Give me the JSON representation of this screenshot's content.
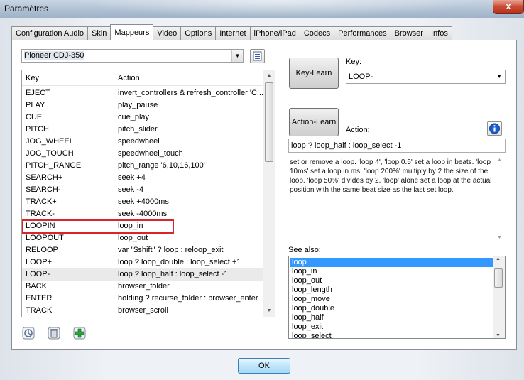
{
  "window": {
    "title": "Paramètres",
    "close_label": "x"
  },
  "tabs": [
    {
      "label": "Configuration Audio",
      "active": false
    },
    {
      "label": "Skin",
      "active": false
    },
    {
      "label": "Mappeurs",
      "active": true
    },
    {
      "label": "Video",
      "active": false
    },
    {
      "label": "Options",
      "active": false
    },
    {
      "label": "Internet",
      "active": false
    },
    {
      "label": "iPhone/iPad",
      "active": false
    },
    {
      "label": "Codecs",
      "active": false
    },
    {
      "label": "Performances",
      "active": false
    },
    {
      "label": "Browser",
      "active": false
    },
    {
      "label": "Infos",
      "active": false
    }
  ],
  "device": {
    "selected": "Pioneer CDJ-350",
    "arrow": "▼"
  },
  "mapping": {
    "headers": {
      "key": "Key",
      "action": "Action"
    },
    "rows": [
      {
        "key": "EJECT",
        "action": "invert_controllers & refresh_controller 'C..."
      },
      {
        "key": "PLAY",
        "action": "play_pause"
      },
      {
        "key": "CUE",
        "action": "cue_play"
      },
      {
        "key": "PITCH",
        "action": "pitch_slider"
      },
      {
        "key": "JOG_WHEEL",
        "action": "speedwheel"
      },
      {
        "key": "JOG_TOUCH",
        "action": "speedwheel_touch"
      },
      {
        "key": "PITCH_RANGE",
        "action": "pitch_range '6,10,16,100'"
      },
      {
        "key": "SEARCH+",
        "action": "seek +4"
      },
      {
        "key": "SEARCH-",
        "action": "seek -4"
      },
      {
        "key": "TRACK+",
        "action": "seek +4000ms"
      },
      {
        "key": "TRACK-",
        "action": "seek -4000ms"
      },
      {
        "key": "LOOPIN",
        "action": "loop_in"
      },
      {
        "key": "LOOPOUT",
        "action": "loop_out"
      },
      {
        "key": "RELOOP",
        "action": "var \"$shift\" ? loop : reloop_exit"
      },
      {
        "key": "LOOP+",
        "action": "loop ? loop_double : loop_select +1"
      },
      {
        "key": "LOOP-",
        "action": "loop ? loop_half : loop_select -1"
      },
      {
        "key": "BACK",
        "action": "browser_folder"
      },
      {
        "key": "ENTER",
        "action": "holding ? recurse_folder : browser_enter"
      },
      {
        "key": "TRACK",
        "action": "browser_scroll"
      }
    ],
    "selected_index": 15,
    "highlighted_index": 11
  },
  "key_learn": {
    "button_label": "Key-Learn",
    "field_label": "Key:",
    "value": "LOOP-"
  },
  "action_learn": {
    "button_label": "Action-Learn",
    "field_label": "Action:",
    "value": "loop ? loop_half : loop_select -1"
  },
  "description": "set or remove a loop. 'loop 4', 'loop 0.5' set a loop in beats. 'loop 10ms' set a loop in ms. 'loop 200%' multiply by 2 the size of the loop. 'loop 50%' divides by 2. 'loop' alone set a loop at the actual position with the same beat size as the last set loop.",
  "see_also": {
    "label": "See also:",
    "items": [
      "loop",
      "loop_in",
      "loop_out",
      "loop_length",
      "loop_move",
      "loop_double",
      "loop_half",
      "loop_exit",
      "loop_select"
    ]
  },
  "ok_label": "OK",
  "colors": {
    "highlight": "#d9252a",
    "selection": "#3399ff",
    "info": "#1c5fc9"
  }
}
